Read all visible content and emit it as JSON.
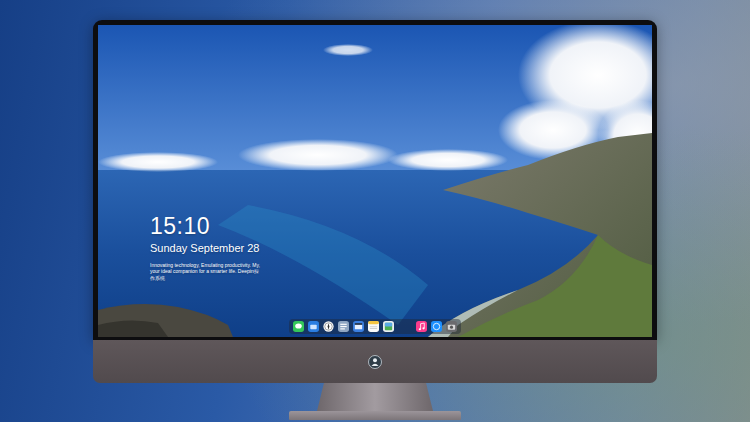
{
  "lock_screen": {
    "time": "15:10",
    "date": "Sunday September 28",
    "tagline": "Innovating technology, Emulating productivity. My, your ideal companion for a smarter life. Deepin操作系统"
  }
}
